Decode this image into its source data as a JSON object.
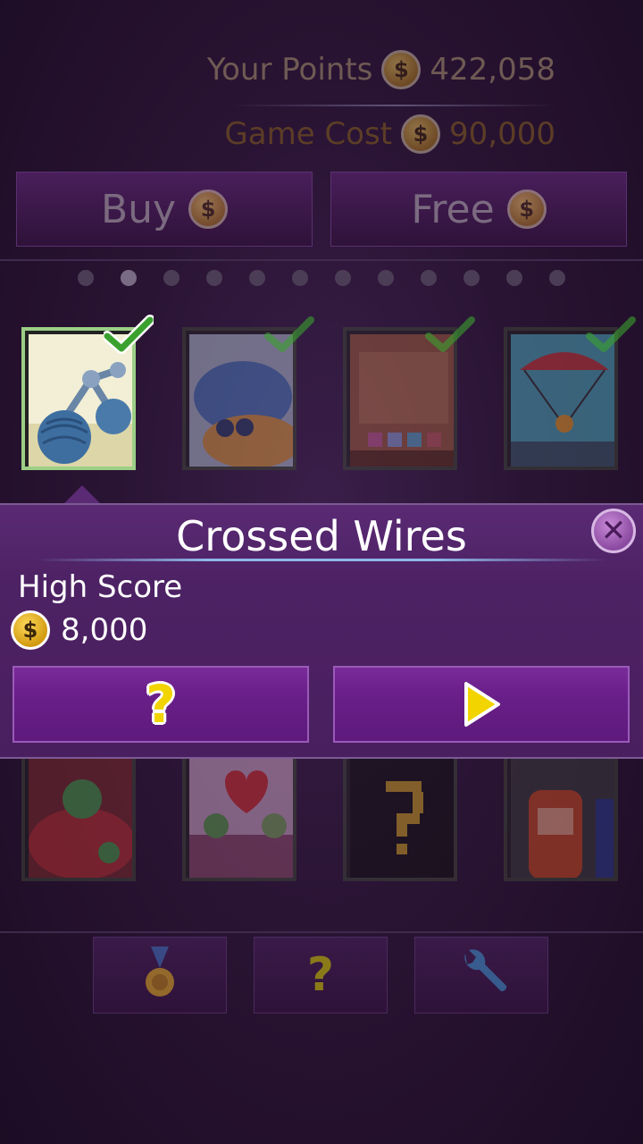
{
  "header": {
    "points_label": "Your Points",
    "points_value": "422,058",
    "cost_label": "Game Cost",
    "cost_value": "90,000",
    "coin_symbol": "$"
  },
  "actions": {
    "buy_label": "Buy",
    "free_label": "Free"
  },
  "pager": {
    "total": 12,
    "active_index": 1
  },
  "games_row_top": [
    {
      "name": "crossed-wires",
      "owned": true,
      "selected": true
    },
    {
      "name": "game-2",
      "owned": true,
      "selected": false
    },
    {
      "name": "game-3",
      "owned": true,
      "selected": false
    },
    {
      "name": "game-4",
      "owned": true,
      "selected": false
    }
  ],
  "games_row_bottom": [
    {
      "name": "game-5"
    },
    {
      "name": "game-6"
    },
    {
      "name": "game-7"
    },
    {
      "name": "game-8"
    }
  ],
  "popup": {
    "title": "Crossed Wires",
    "close_symbol": "✕",
    "high_score_label": "High Score",
    "high_score_value": "8,000",
    "help_symbol": "?",
    "play_icon": "play-icon"
  },
  "bottom_nav": {
    "items": [
      "medal-icon",
      "help-icon",
      "wrench-icon"
    ],
    "help_symbol": "?"
  },
  "colors": {
    "accent_purple": "#6a1f8a",
    "check_green": "#4caf3c",
    "coin_gold": "#d19a10"
  }
}
